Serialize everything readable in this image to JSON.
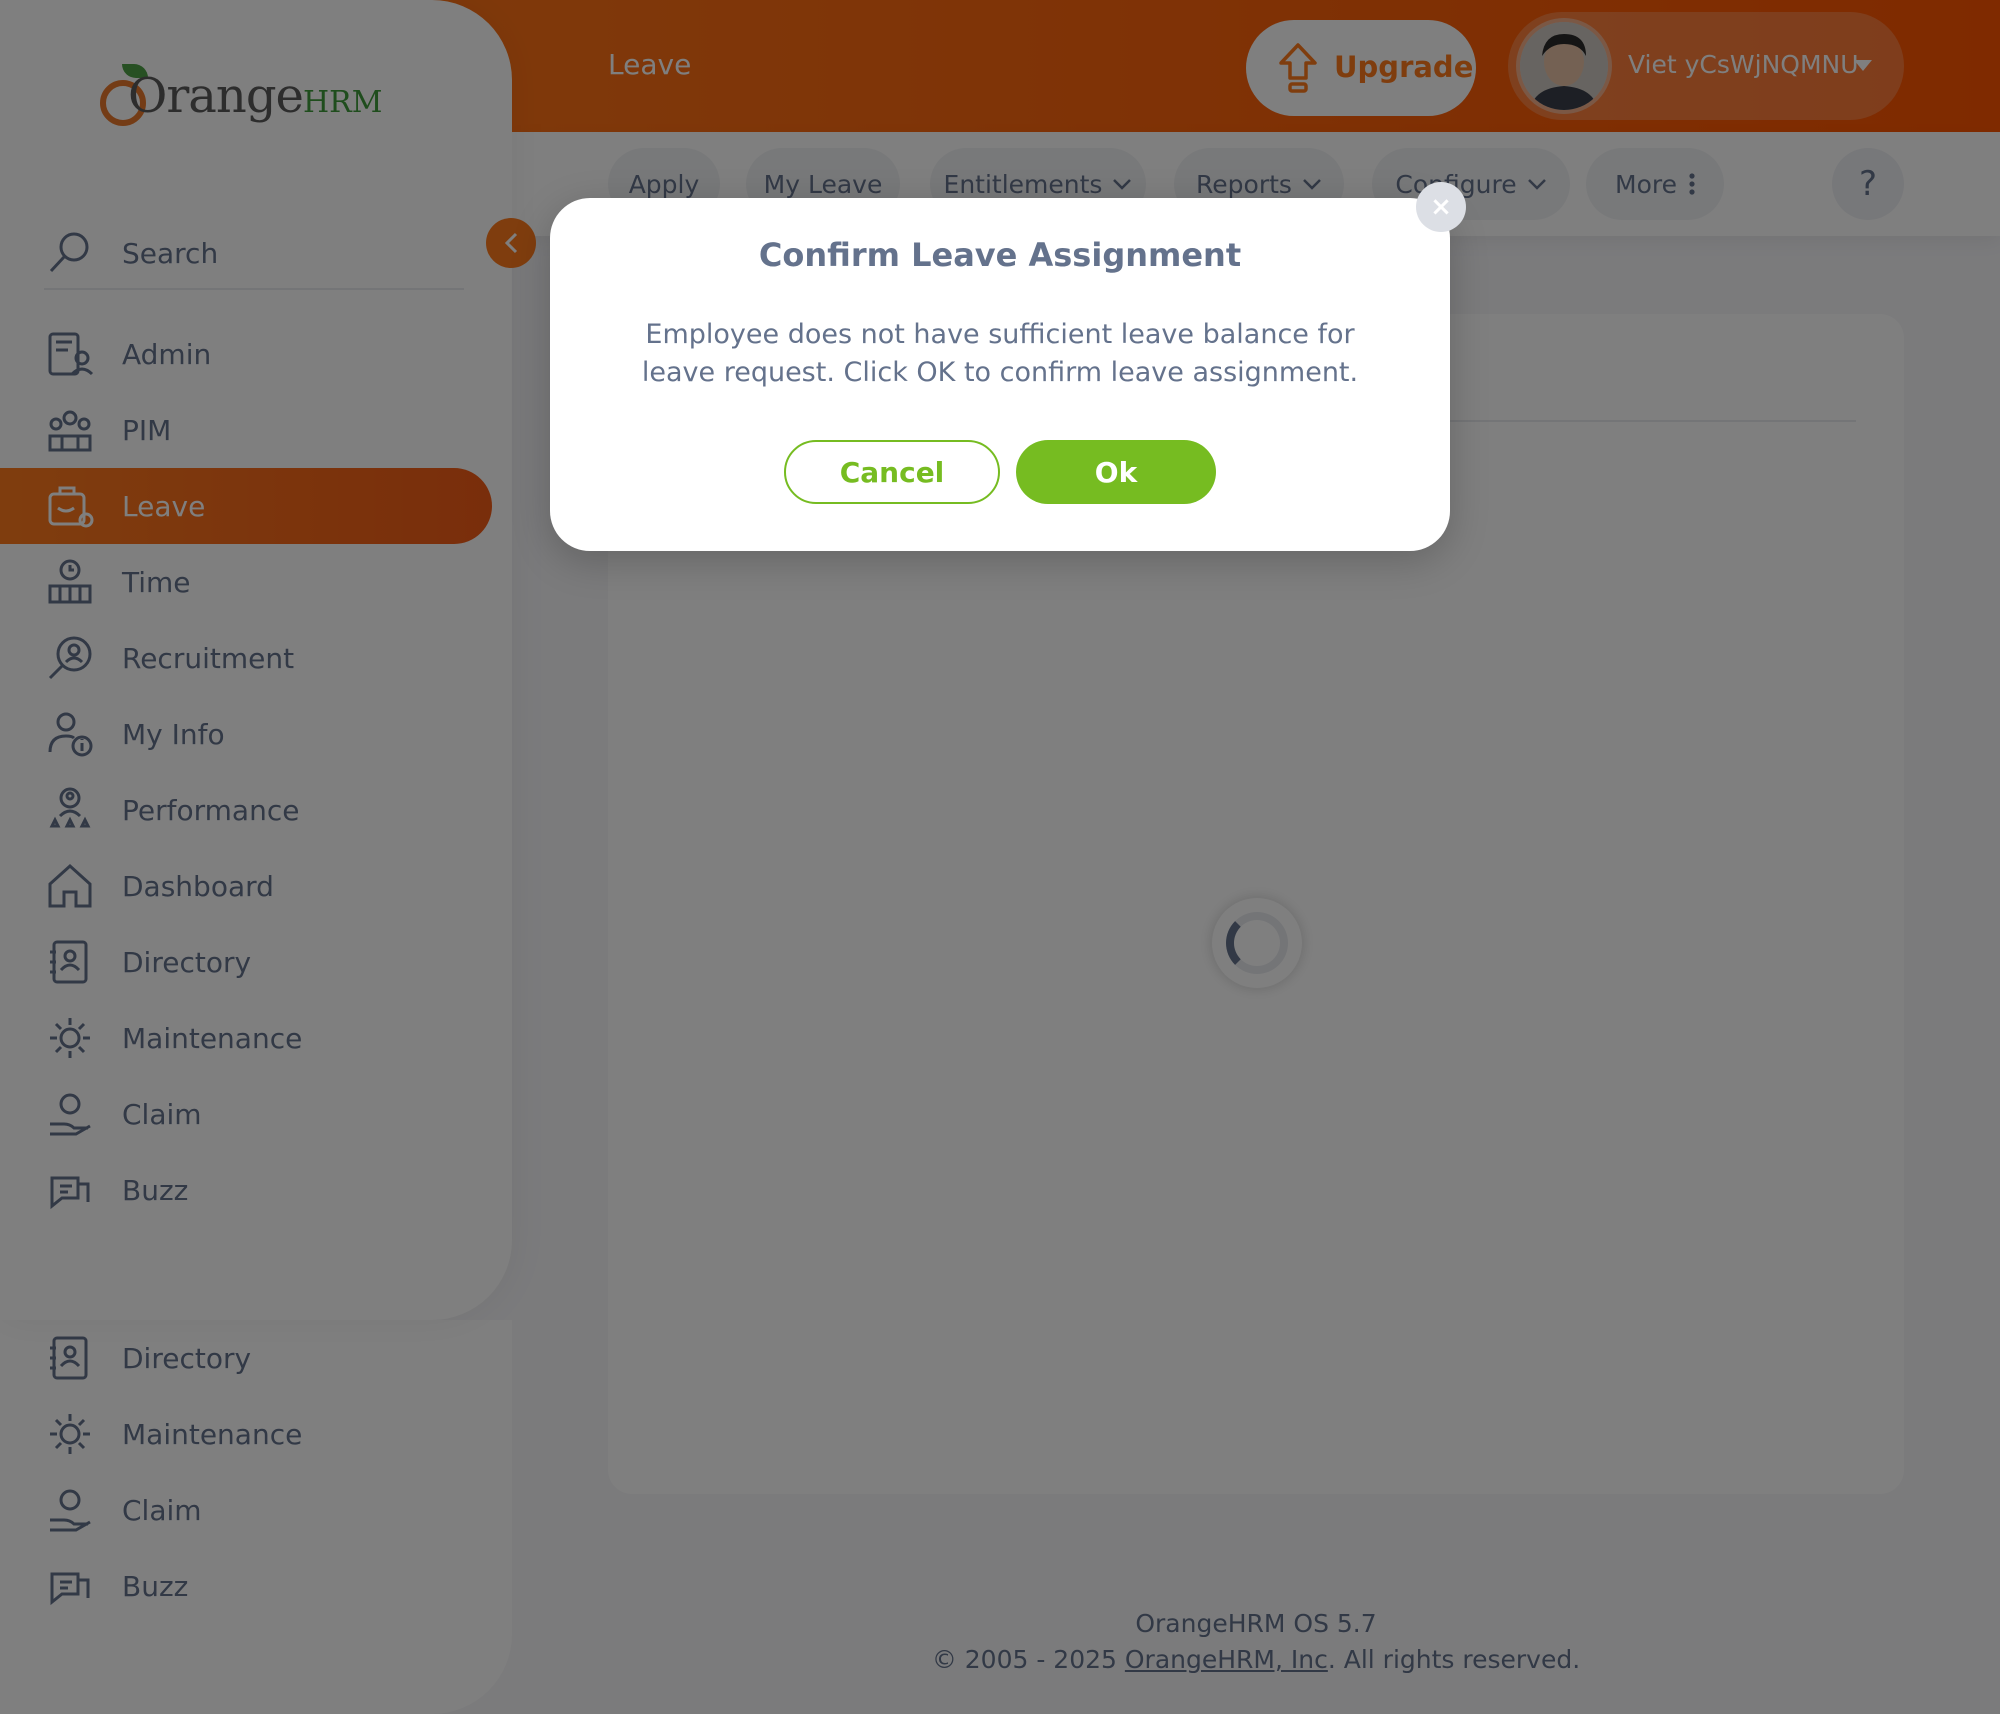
{
  "app": {
    "brand_text": "Orange",
    "brand_suffix": "HRM"
  },
  "topbar": {
    "title": "Leave",
    "upgrade_label": "Upgrade",
    "user_name": "Viet yCsWjNQMNU"
  },
  "sidebar": {
    "search_label": "Search",
    "items": [
      {
        "label": "Admin",
        "icon": "admin-icon"
      },
      {
        "label": "PIM",
        "icon": "pim-icon"
      },
      {
        "label": "Leave",
        "icon": "leave-icon",
        "active": true
      },
      {
        "label": "Time",
        "icon": "time-icon"
      },
      {
        "label": "Recruitment",
        "icon": "recruitment-icon"
      },
      {
        "label": "My Info",
        "icon": "my-info-icon"
      },
      {
        "label": "Performance",
        "icon": "performance-icon"
      },
      {
        "label": "Dashboard",
        "icon": "dashboard-icon"
      },
      {
        "label": "Directory",
        "icon": "directory-icon"
      },
      {
        "label": "Maintenance",
        "icon": "maintenance-icon"
      },
      {
        "label": "Claim",
        "icon": "claim-icon"
      },
      {
        "label": "Buzz",
        "icon": "buzz-icon"
      }
    ],
    "lower_items": [
      {
        "label": "Directory",
        "icon": "directory-icon"
      },
      {
        "label": "Maintenance",
        "icon": "maintenance-icon"
      },
      {
        "label": "Claim",
        "icon": "claim-icon"
      },
      {
        "label": "Buzz",
        "icon": "buzz-icon"
      }
    ]
  },
  "subnav": {
    "tabs": [
      {
        "label": "Apply"
      },
      {
        "label": "My Leave"
      },
      {
        "label": "Entitlements",
        "dropdown": true
      },
      {
        "label": "Reports",
        "dropdown": true
      },
      {
        "label": "Configure",
        "dropdown": true
      },
      {
        "label": "More",
        "menu": true
      }
    ],
    "help_label": "?"
  },
  "modal": {
    "title": "Confirm Leave Assignment",
    "body": "Employee does not have sufficient leave balance for leave request. Click OK to confirm leave assignment.",
    "cancel_label": "Cancel",
    "ok_label": "Ok",
    "close_label": "×"
  },
  "footer": {
    "version": "OrangeHRM OS 5.7",
    "copyright_prefix": "© 2005 - 2025 ",
    "company_link": "OrangeHRM, Inc",
    "copyright_suffix": ". All rights reserved."
  },
  "colors": {
    "accent": "#ff7b1d",
    "success": "#76bc21",
    "text": "#64728c"
  }
}
